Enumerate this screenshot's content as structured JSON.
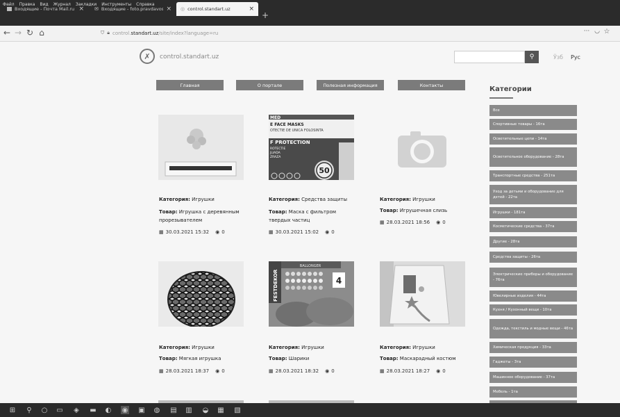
{
  "browser": {
    "menu": [
      "Файл",
      "Правка",
      "Вид",
      "Журнал",
      "Закладки",
      "Инструменты",
      "Справка"
    ],
    "tabs": [
      {
        "label": "Входящие - Почта Mail.ru"
      },
      {
        "label": "Входящие - foto.pravdavosto..."
      },
      {
        "label": "control.standart.uz"
      }
    ],
    "url_prefix": "control.",
    "url_domain": "standart.uz",
    "url_path": "/site/index?language=ru"
  },
  "site": {
    "logo_text": "control.standart.uz",
    "lang_uz": "Ўзб",
    "lang_ru": "Рус",
    "nav": [
      "Главная",
      "О портале",
      "Полезная информация",
      "Контакты"
    ]
  },
  "labels": {
    "category": "Категория:",
    "product": "Товар:"
  },
  "products": [
    {
      "category": "Игрушки",
      "name_l1": "Игрушка с деревянным",
      "name_l2": "прорезывателем",
      "date": "30.03.2021 15:32",
      "views": "0"
    },
    {
      "category": "Средства защиты",
      "name_l1": "Маска с фильтром",
      "name_l2": "твердых частиц",
      "date": "30.03.2021 15:02",
      "views": "0"
    },
    {
      "category": "Игрушки",
      "name_l1": "Игрушечная слизь",
      "name_l2": "",
      "date": "28.03.2021 18:56",
      "views": "0"
    },
    {
      "category": "Игрушки",
      "name_l1": "Мягкая игрушка",
      "name_l2": "",
      "date": "28.03.2021 18:37",
      "views": "0"
    },
    {
      "category": "Игрушки",
      "name_l1": "Шарики",
      "name_l2": "",
      "date": "28.03.2021 18:32",
      "views": "0"
    },
    {
      "category": "Игрушки",
      "name_l1": "Маскарадный костюм",
      "name_l2": "",
      "date": "28.03.2021 18:27",
      "views": "0"
    }
  ],
  "mask_pack": {
    "brand": "MED",
    "line1": "E FACE MASKS",
    "line2": "OTECTIE DE UNICA FOLOSINTA",
    "line3": "F PROTECTION",
    "line4": "ROTECTIE",
    "line5": "JLIADA",
    "line6": "ZRAZA",
    "count": "50"
  },
  "balloons_pack": {
    "brand": "FESTDEKOR",
    "sub": "BALLONGER",
    "count": "4"
  },
  "sidebar": {
    "title": "Категории",
    "items": [
      "Все",
      "Спортивные товары - 16та",
      "Осветительные цепи - 14та",
      "Осветительное оборудование - 28та",
      "Транспортные средства - 251та",
      "Уход за детьми и оборудование для детей - 22та",
      "Игрушки - 181та",
      "Косметические средства - 37та",
      "Другие - 28та",
      "Средства защиты - 26та",
      "Электрические приборы и оборудование - 76та",
      "Ювелирные изделия - 44та",
      "Кухня / Кухонный вещи - 10та",
      "Одежда, текстиль и модные вещи - 46та",
      "Химическая продукция - 33та",
      "Гаджеты - 3та",
      "Машинное оборудование - 37та",
      "Мебель - 1та"
    ]
  }
}
